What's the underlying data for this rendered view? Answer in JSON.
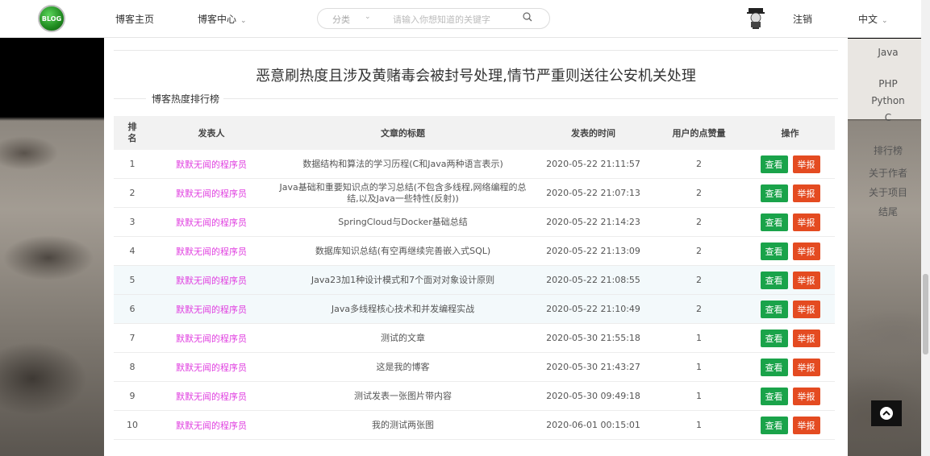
{
  "nav": {
    "logo_text": "BLOG",
    "home": "博客主页",
    "center": "博客中心",
    "search": {
      "category": "分类",
      "placeholder": "请输入你想知道的关键字"
    },
    "logout": "注销",
    "language": "中文"
  },
  "sidebar": {
    "items": [
      "Java",
      "PHP",
      "Python",
      "C",
      "排行榜",
      "关于作者",
      "关于项目",
      "结尾"
    ]
  },
  "panel": {
    "warning": "恶意刷热度且涉及黄赌毒会被封号处理,情节严重则送往公安机关处理",
    "legend": "博客热度排行榜"
  },
  "table": {
    "headers": [
      "排名",
      "发表人",
      "文章的标题",
      "发表的时间",
      "用户的点赞量",
      "操作"
    ],
    "view_label": "查看",
    "report_label": "举报",
    "rows": [
      {
        "rank": "1",
        "author": "默默无闻的程序员",
        "title": "数据结构和算法的学习历程(C和Java两种语言表示)",
        "time": "2020-05-22 21:11:57",
        "likes": "2"
      },
      {
        "rank": "2",
        "author": "默默无闻的程序员",
        "title": "Java基础和重要知识点的学习总结(不包含多线程,网络编程的总结,以及Java一些特性(反射))",
        "time": "2020-05-22 21:07:13",
        "likes": "2"
      },
      {
        "rank": "3",
        "author": "默默无闻的程序员",
        "title": "SpringCloud与Docker基础总结",
        "time": "2020-05-22 21:14:23",
        "likes": "2"
      },
      {
        "rank": "4",
        "author": "默默无闻的程序员",
        "title": "数据库知识总结(有空再继续完善嵌入式SQL)",
        "time": "2020-05-22 21:13:09",
        "likes": "2"
      },
      {
        "rank": "5",
        "author": "默默无闻的程序员",
        "title": "Java23加1种设计模式和7个面对对象设计原则",
        "time": "2020-05-22 21:08:55",
        "likes": "2"
      },
      {
        "rank": "6",
        "author": "默默无闻的程序员",
        "title": "Java多线程核心技术和并发编程实战",
        "time": "2020-05-22 21:10:49",
        "likes": "2"
      },
      {
        "rank": "7",
        "author": "默默无闻的程序员",
        "title": "测试的文章",
        "time": "2020-05-30 21:55:18",
        "likes": "1"
      },
      {
        "rank": "8",
        "author": "默默无闻的程序员",
        "title": "这是我的博客",
        "time": "2020-05-30 21:43:27",
        "likes": "1"
      },
      {
        "rank": "9",
        "author": "默默无闻的程序员",
        "title": "测试发表一张图片带内容",
        "time": "2020-05-30 09:49:18",
        "likes": "1"
      },
      {
        "rank": "10",
        "author": "默默无闻的程序员",
        "title": "我的测试两张图",
        "time": "2020-06-01 00:15:01",
        "likes": "1"
      }
    ]
  }
}
